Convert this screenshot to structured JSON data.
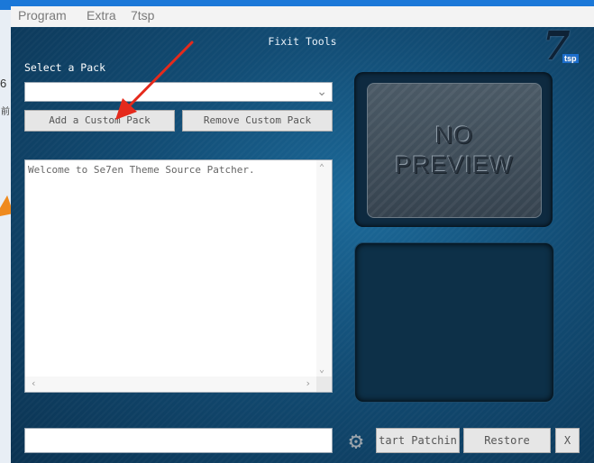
{
  "menu": {
    "items": [
      "Program",
      "Extra",
      "7tsp"
    ]
  },
  "background_app": {
    "fragment_top": "6",
    "fragment_mid": "前"
  },
  "window": {
    "title": "Fixit Tools",
    "logo_mark": "7",
    "logo_sub": "tsp"
  },
  "pack": {
    "label": "Select a Pack",
    "selected_value": "",
    "add_button": "Add a Custom Pack",
    "remove_button": "Remove Custom Pack"
  },
  "log": {
    "text": "Welcome to Se7en Theme Source Patcher."
  },
  "preview": {
    "line1": "NO",
    "line2": "PREVIEW"
  },
  "footer": {
    "path_value": "",
    "start_button": "tart Patchin",
    "restore_button": "Restore",
    "close_button": "X"
  },
  "colors": {
    "accent_arrow": "#e52a1c",
    "window_bg": "#124c74"
  },
  "icons": {
    "dropdown": "chevron-down-icon",
    "gear": "gear-icon"
  }
}
